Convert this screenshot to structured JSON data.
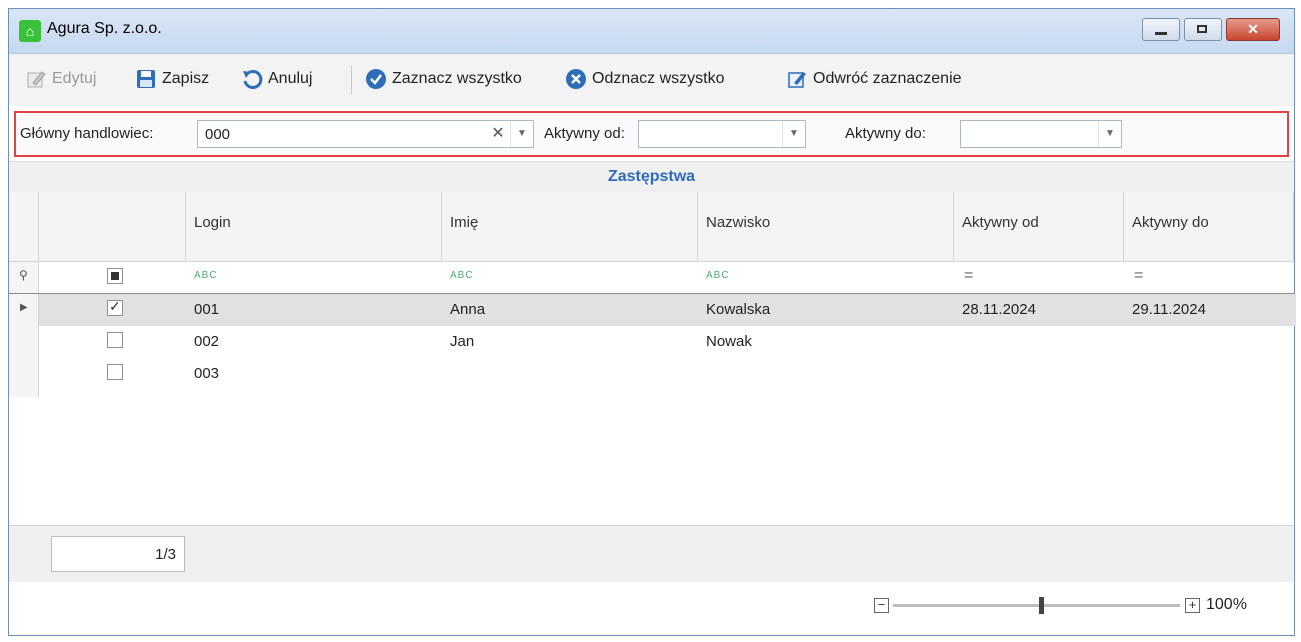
{
  "window": {
    "title": "Agura Sp. z.o.o.",
    "close_glyph": "✕"
  },
  "toolbar": {
    "edit": "Edytuj",
    "save": "Zapisz",
    "cancel": "Anuluj",
    "select_all": "Zaznacz wszystko",
    "deselect_all": "Odznacz wszystko",
    "invert": "Odwróć zaznaczenie"
  },
  "filters": {
    "main_salesman_label": "Główny handlowiec:",
    "main_salesman_value": "000",
    "active_from_label": "Aktywny od:",
    "active_from_value": "",
    "active_to_label": "Aktywny do:",
    "active_to_value": ""
  },
  "grid": {
    "title": "Zastępstwa",
    "columns": [
      "Login",
      "Imię",
      "Nazwisko",
      "Aktywny od",
      "Aktywny do"
    ],
    "filter_text_glyph": "ABC",
    "filter_eq_glyph": "=",
    "rows": [
      {
        "checked": true,
        "login": "001",
        "first": "Anna",
        "last": "Kowalska",
        "from": "28.11.2024",
        "to": "29.11.2024"
      },
      {
        "checked": false,
        "login": "002",
        "first": "Jan",
        "last": "Nowak",
        "from": "",
        "to": ""
      },
      {
        "checked": false,
        "login": "003",
        "first": "",
        "last": "",
        "from": "",
        "to": ""
      }
    ]
  },
  "pager": {
    "text": "1/3"
  },
  "zoom": {
    "label": "100%",
    "minus": "−",
    "plus": "+"
  },
  "colors": {
    "accent": "#2d6bbf",
    "filter_border": "#e34141"
  }
}
